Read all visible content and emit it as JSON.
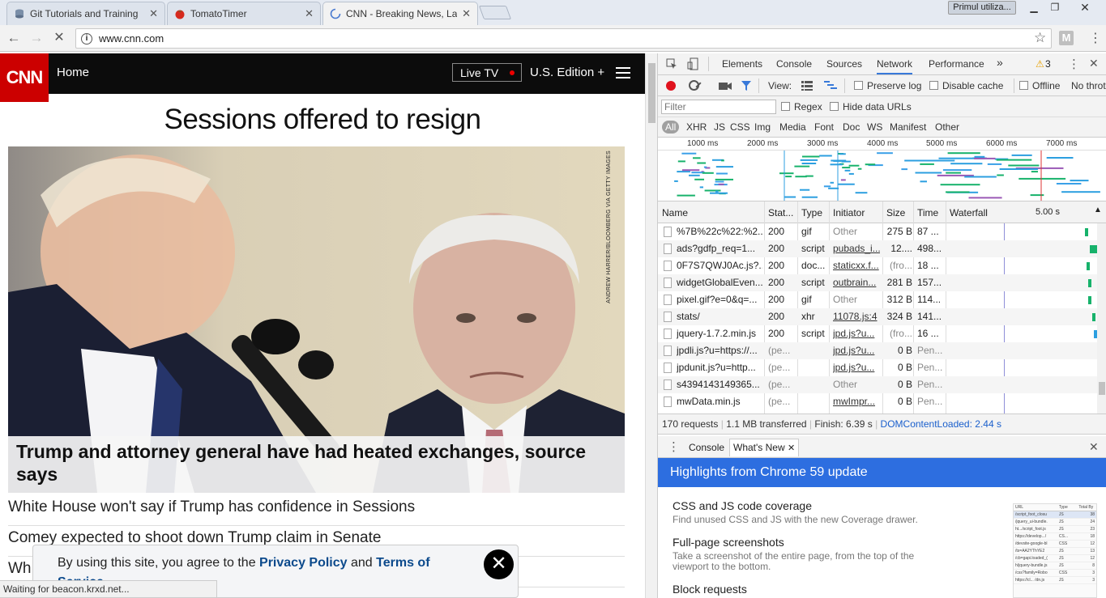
{
  "browser": {
    "tabs": [
      {
        "label": "Git Tutorials and Training",
        "icon": "git-page-icon"
      },
      {
        "label": "TomatoTimer",
        "icon": "tomato-icon"
      },
      {
        "label": "CNN - Breaking News, La",
        "icon": "loading-spinner-icon",
        "active": true
      }
    ],
    "profile_label": "Primul utiliza...",
    "url": "www.cnn.com"
  },
  "page": {
    "logo": "CNN",
    "nav": {
      "home": "Home",
      "live_tv": "Live TV",
      "edition": "U.S. Edition +"
    },
    "headline": "Sessions offered to resign",
    "photo_credit": "ANDREW HARRER/BLOOMBERG VIA GETTY IMAGES",
    "caption": "Trump and attorney general have had heated exchanges, source says",
    "stories": [
      "White House won't say if Trump has confidence in Sessions",
      "Comey expected to shoot down Trump claim in Senate",
      "Wh"
    ],
    "consent": {
      "prefix": "By using this site, you agree to the ",
      "privacy": "Privacy Policy",
      "and": " and ",
      "terms": "Terms of Service"
    },
    "status": "Waiting for beacon.krxd.net..."
  },
  "devtools": {
    "tabs": [
      "Elements",
      "Console",
      "Sources",
      "Network",
      "Performance"
    ],
    "active_tab": "Network",
    "more": "»",
    "warnings": "3",
    "toolbar": {
      "view": "View:",
      "preserve_log": "Preserve log",
      "disable_cache": "Disable cache",
      "offline": "Offline",
      "throttle": "No throt"
    },
    "filter": {
      "placeholder": "Filter",
      "regex": "Regex",
      "hide_data_urls": "Hide data URLs"
    },
    "types": [
      "All",
      "XHR",
      "JS",
      "CSS",
      "Img",
      "Media",
      "Font",
      "Doc",
      "WS",
      "Manifest",
      "Other"
    ],
    "ticks": [
      "1000 ms",
      "2000 ms",
      "3000 ms",
      "4000 ms",
      "5000 ms",
      "6000 ms",
      "7000 ms"
    ],
    "columns": {
      "name": "Name",
      "status": "Stat...",
      "type": "Type",
      "initiator": "Initiator",
      "size": "Size",
      "time": "Time",
      "waterfall": "Waterfall",
      "waterfall_time": "5.00 s"
    },
    "requests": [
      {
        "name": "%7B%22c%22:%2...",
        "status": "200",
        "type": "gif",
        "initiator": "Other",
        "size": "275 B",
        "time": "87 ...",
        "wf": 0.93
      },
      {
        "name": "ads?gdfp_req=1...",
        "status": "200",
        "type": "script",
        "initiator": "pubads_i...",
        "size": "12....",
        "time": "498...",
        "wf": 0.96
      },
      {
        "name": "0F7S7QWJ0Ac.js?...",
        "status": "200",
        "type": "doc...",
        "initiator": "staticxx.f...",
        "size": "(fro...",
        "time": "18 ...",
        "wf": 0.94
      },
      {
        "name": "widgetGlobalEven...",
        "status": "200",
        "type": "script",
        "initiator": "outbrain...",
        "size": "281 B",
        "time": "157...",
        "wf": 0.95
      },
      {
        "name": "pixel.gif?e=0&q=...",
        "status": "200",
        "type": "gif",
        "initiator": "Other",
        "size": "312 B",
        "time": "114...",
        "wf": 0.95
      },
      {
        "name": "stats/",
        "status": "200",
        "type": "xhr",
        "initiator": "11078.js:4",
        "size": "324 B",
        "time": "141...",
        "wf": 0.98
      },
      {
        "name": "jquery-1.7.2.min.js",
        "status": "200",
        "type": "script",
        "initiator": "jpd.js?u...",
        "size": "(fro...",
        "time": "16 ...",
        "wf": 0.99
      },
      {
        "name": "jpdli.js?u=https://...",
        "status": "(pe...",
        "type": "",
        "initiator": "jpd.js?u...",
        "size": "0 B",
        "time": "Pen...",
        "wf": null
      },
      {
        "name": "jpdunit.js?u=http...",
        "status": "(pe...",
        "type": "",
        "initiator": "jpd.js?u...",
        "size": "0 B",
        "time": "Pen...",
        "wf": null
      },
      {
        "name": "s4394143149365...",
        "status": "(pe...",
        "type": "",
        "initiator": "Other",
        "size": "0 B",
        "time": "Pen...",
        "wf": null
      },
      {
        "name": "mwData.min.js",
        "status": "(pe...",
        "type": "",
        "initiator": "mwImpr...",
        "size": "0 B",
        "time": "Pen...",
        "wf": null
      }
    ],
    "summary": {
      "requests": "170 requests",
      "transferred": "1.1 MB transferred",
      "finish": "Finish: 6.39 s",
      "dcl": "DOMContentLoaded: 2.44 s"
    },
    "drawer": {
      "console": "Console",
      "whats_new": "What's New"
    },
    "highlights": "Highlights from Chrome 59 update",
    "features": [
      {
        "title": "CSS and JS code coverage",
        "desc": "Find unused CSS and JS with the new Coverage drawer."
      },
      {
        "title": "Full-page screenshots",
        "desc": "Take a screenshot of the entire page, from the top of the viewport to the bottom."
      },
      {
        "title": "Block requests",
        "desc": ""
      }
    ],
    "coverage_preview": {
      "headers": [
        "URL",
        "Type",
        "Total By"
      ],
      "rows": [
        [
          "/script_foot_closu",
          "JS",
          "38"
        ],
        [
          "/jquery_ui-bundle.",
          "JS",
          "24"
        ],
        [
          "ht.../script_foot.js",
          "JS",
          "23"
        ],
        [
          "https://develop.../",
          "CS...",
          "18"
        ],
        [
          "/devsite-google-bl",
          "CSS",
          "12"
        ],
        [
          "/ts=AA2YThYE2",
          "JS",
          "13"
        ],
        [
          "/cb=gapi.loaded_(",
          "JS",
          "12"
        ],
        [
          "h/jquery-bundle.js",
          "JS",
          "8"
        ],
        [
          "/css?family=Robo",
          "CSS",
          "3"
        ],
        [
          "https://cl... /dn.js",
          "JS",
          "3"
        ]
      ]
    }
  }
}
